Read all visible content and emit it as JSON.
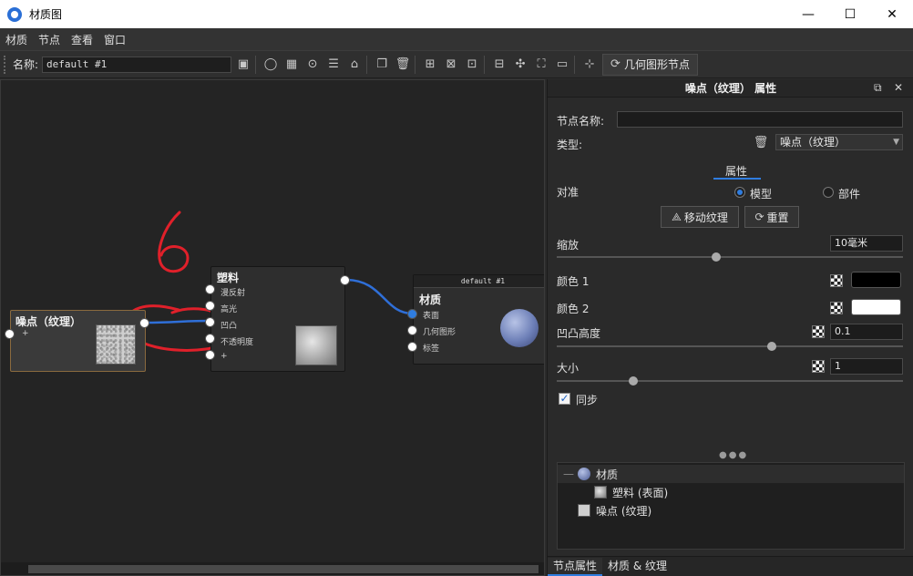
{
  "window": {
    "title": "材质图",
    "minimize": "—",
    "maximize": "☐",
    "close": "✕"
  },
  "menu": [
    "材质",
    "节点",
    "查看",
    "窗口"
  ],
  "toolbar": {
    "name_label": "名称:",
    "name_value": "default #1",
    "geometry_node_button": "几何图形节点"
  },
  "canvas": {
    "annotation_text": "6",
    "nodes": {
      "noise": {
        "title": "噪点（纹理）",
        "add_socket": "+"
      },
      "plastic": {
        "title": "塑料",
        "inputs": [
          "漫反射",
          "高光",
          "凹凸",
          "不透明度",
          "+"
        ]
      },
      "material": {
        "header": "default #1",
        "title": "材质",
        "inputs": [
          "表面",
          "几何图形",
          "标签"
        ]
      }
    }
  },
  "panel": {
    "title": "噪点（纹理） 属性",
    "node_name_label": "节点名称:",
    "node_name_value": "",
    "type_label": "类型:",
    "type_value": "噪点（纹理）",
    "attr_tab": "属性",
    "align_label": "对准",
    "align_options": [
      "模型",
      "部件"
    ],
    "align_selected": "模型",
    "move_texture_button": "移动纹理",
    "reset_button": "重置",
    "scale_label": "缩放",
    "scale_value": "10毫米",
    "scale_slider": 0.46,
    "color1_label": "颜色 1",
    "color1_value": "#000000",
    "color2_label": "颜色 2",
    "color2_value": "#ffffff",
    "bump_label": "凹凸高度",
    "bump_value": "0.1",
    "bump_slider": 0.62,
    "size_label": "大小",
    "size_value": "1",
    "size_slider": 0.22,
    "sync_label": "同步",
    "sync_checked": true,
    "tree": [
      {
        "label": "材质",
        "icon": "sphere-icon"
      },
      {
        "label": "塑料 (表面)",
        "icon": "plastic-thumb-icon"
      },
      {
        "label": "噪点 (纹理)",
        "icon": "noise-thumb-icon"
      }
    ],
    "bottom_tabs": [
      "节点属性",
      "材质 & 纹理"
    ]
  }
}
